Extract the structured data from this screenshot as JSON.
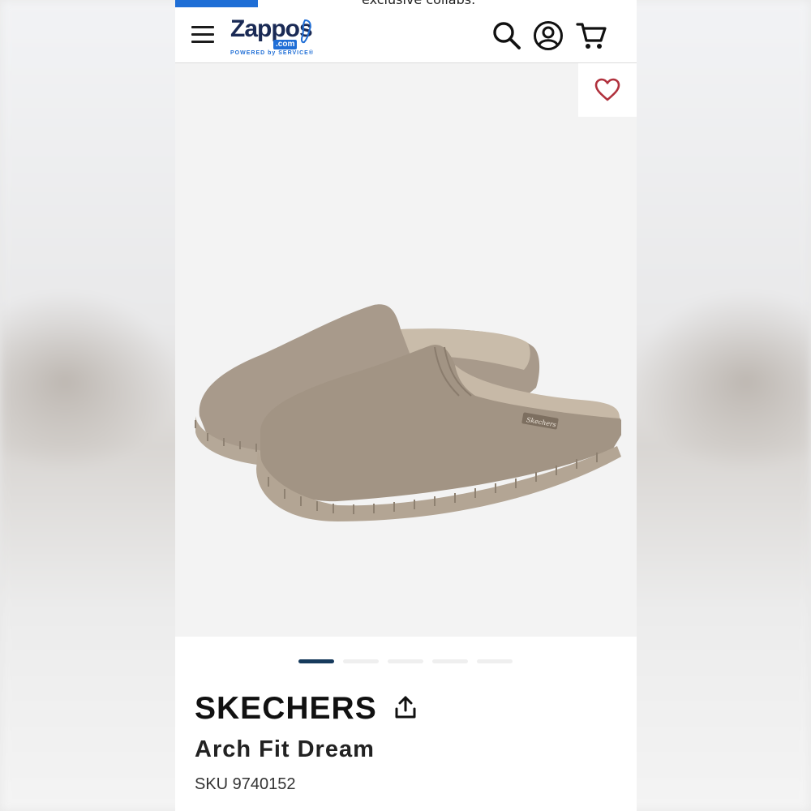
{
  "promo": {
    "text": "exclusive collabs."
  },
  "header": {
    "logo_word": "Zappos",
    "logo_dotcom": ".com",
    "logo_tagline": "POWERED by SERVICE®",
    "menu_icon": "hamburger-menu-icon",
    "search_icon": "search-icon",
    "account_icon": "account-icon",
    "cart_icon": "cart-icon"
  },
  "product": {
    "brand": "SKECHERS",
    "name": "Arch Fit Dream",
    "sku_label": "SKU",
    "sku_value": "9740152",
    "sku": "SKU 9740152",
    "image_count": 5,
    "active_image": 1,
    "shoe_label": "Skechers"
  },
  "colors": {
    "accent_blue": "#1f6ed6",
    "active_dot": "#163a5c",
    "heart": "#b0313d",
    "shoe_taupe": "#a89a8b"
  }
}
